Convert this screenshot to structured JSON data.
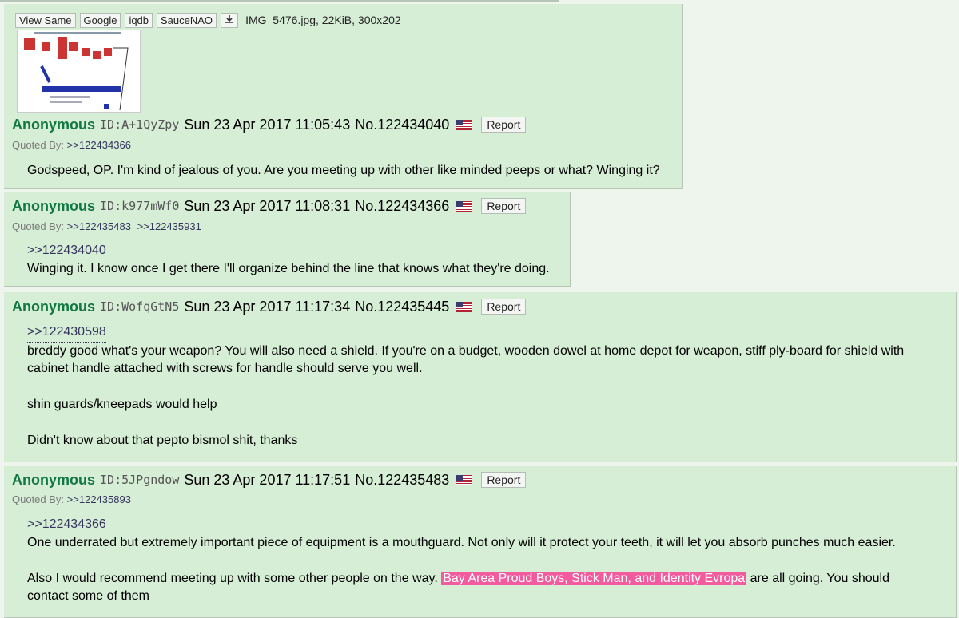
{
  "file": {
    "buttons": [
      "View Same",
      "Google",
      "iqdb",
      "SauceNAO"
    ],
    "download_icon": "download-icon",
    "info": "IMG_5476.jpg, 22KiB, 300x202"
  },
  "posts": [
    {
      "name": "Anonymous",
      "id": "ID:A+1QyZpy",
      "datetime": "Sun 23 Apr 2017 11:05:43",
      "number": "No.122434040",
      "flag": "us-flag-icon",
      "report": "Report",
      "quoted_label": "Quoted By:",
      "quoted_by": [
        ">>122434366"
      ],
      "lines": [
        "Godspeed, OP. I'm kind of jealous of you. Are you meeting up with other like minded peeps or what? Winging it?"
      ]
    },
    {
      "name": "Anonymous",
      "id": "ID:k977mWf0",
      "datetime": "Sun 23 Apr 2017 11:08:31",
      "number": "No.122434366",
      "flag": "us-flag-icon",
      "report": "Report",
      "quoted_label": "Quoted By:",
      "quoted_by": [
        ">>122435483",
        ">>122435931"
      ],
      "reply_link": ">>122434040",
      "lines": [
        "Winging it. I know once I get there I'll organize behind the line that knows what they're doing."
      ]
    },
    {
      "name": "Anonymous",
      "id": "ID:WofqGtN5",
      "datetime": "Sun 23 Apr 2017 11:17:34",
      "number": "No.122435445",
      "flag": "us-flag-icon",
      "report": "Report",
      "reply_link": ">>122430598",
      "lines": [
        "breddy good what's your weapon? You will also need a shield. If you're on a budget, wooden dowel at home depot for weapon, stiff ply-board for shield with",
        "cabinet handle attached with screws for handle should serve you well.",
        "shin guards/kneepads would help",
        "Didn't know about that pepto bismol shit, thanks"
      ]
    },
    {
      "name": "Anonymous",
      "id": "ID:5JPgndow",
      "datetime": "Sun 23 Apr 2017 11:17:51",
      "number": "No.122435483",
      "flag": "us-flag-icon",
      "report": "Report",
      "quoted_label": "Quoted By:",
      "quoted_by": [
        ">>122435893"
      ],
      "reply_link": ">>122434366",
      "lines": [
        "One underrated but extremely important piece of equipment is a mouthguard. Not only will it protect your teeth, it will let you absorb punches much easier.",
        "Also I would recommend meeting up with some other people on the way. ",
        "Bay Area Proud Boys, Stick Man, and Identity Evropa",
        " are all going. You should",
        "contact some of them"
      ]
    }
  ],
  "colors": {
    "post_bg": "#d6edd6",
    "name": "#117743",
    "highlight": "#f25c9f",
    "link": "#34345c"
  }
}
